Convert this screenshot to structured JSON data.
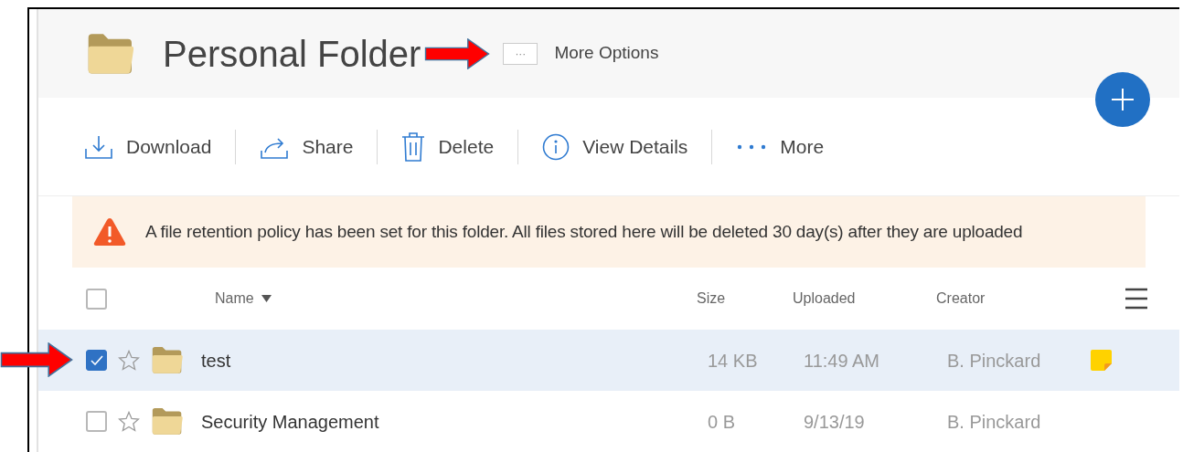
{
  "header": {
    "title": "Personal Folder",
    "more_options": {
      "icon": "···",
      "label": "More Options",
      "pointer_arrow": true
    }
  },
  "toolbar": [
    {
      "kind": "download",
      "label": "Download"
    },
    {
      "kind": "share",
      "label": "Share"
    },
    {
      "kind": "delete",
      "label": "Delete"
    },
    {
      "kind": "details",
      "label": "View Details"
    },
    {
      "kind": "more",
      "label": "More"
    }
  ],
  "banner": {
    "text": "A file retention policy has been set for this folder. All files stored here will be deleted 30 day(s) after they are uploaded"
  },
  "table": {
    "select_all_checked": false,
    "columns": [
      {
        "label": "Name",
        "sorted": true
      },
      {
        "label": "Size",
        "sorted": false
      },
      {
        "label": "Uploaded",
        "sorted": false
      },
      {
        "label": "Creator",
        "sorted": false
      }
    ],
    "rows": [
      {
        "pointer_arrow": true,
        "selected": true,
        "checked": true,
        "starred": false,
        "name": "test",
        "size": "14 KB",
        "uploaded": "11:49 AM",
        "creator": "B. Pinckard",
        "note": true
      },
      {
        "pointer_arrow": false,
        "selected": false,
        "checked": false,
        "starred": false,
        "name": "Security Management",
        "size": "0 B",
        "uploaded": "9/13/19",
        "creator": "B. Pinckard",
        "note": false
      }
    ]
  }
}
